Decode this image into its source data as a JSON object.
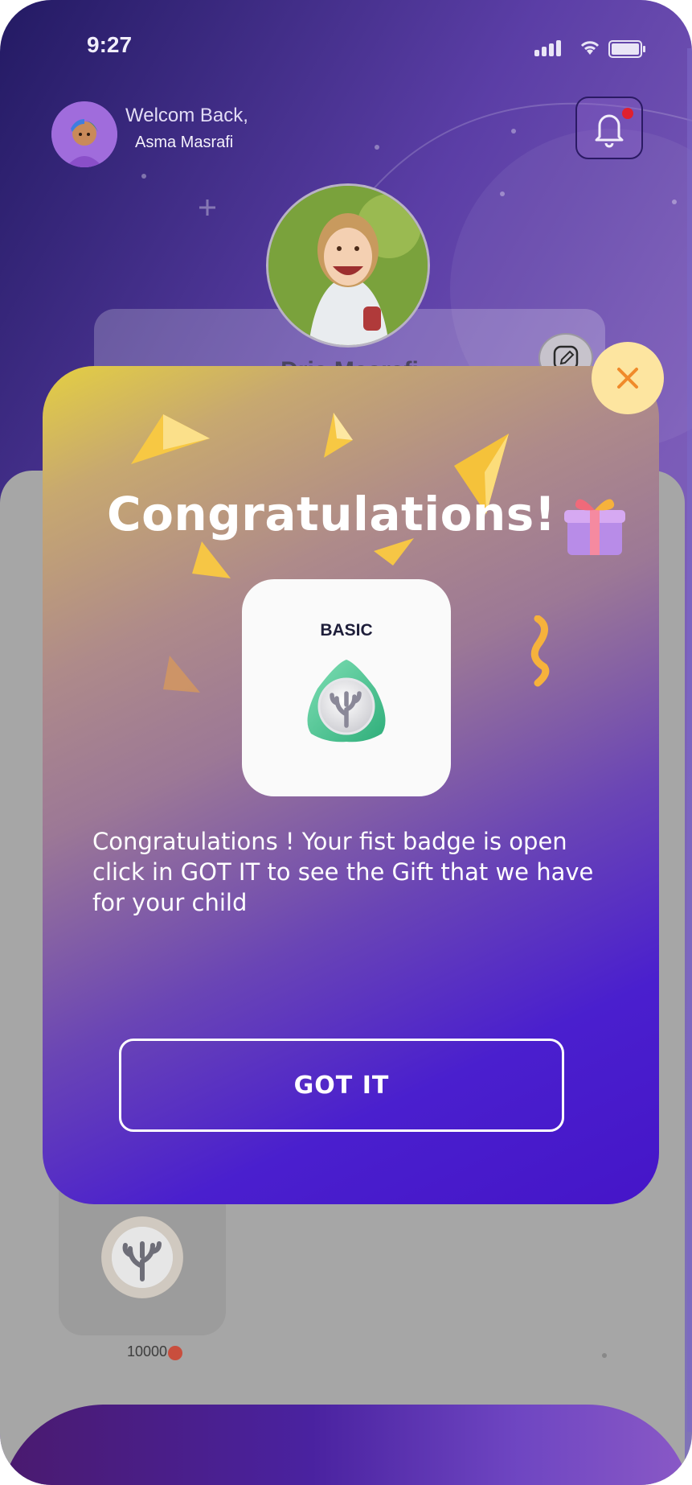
{
  "status_bar": {
    "time": "9:27"
  },
  "header": {
    "welcome_text": "Welcom Back,",
    "user_name": "Asma Masrafi"
  },
  "profile": {
    "child_name": "Dria Masrafi"
  },
  "background_badge": {
    "points": "10000"
  },
  "modal": {
    "title": "Congratulations!",
    "level_label": "BASIC",
    "message": "Congratulations ! Your fist badge is open click in GOT IT to see the Gift that we have for your child",
    "button_label": "GOT IT",
    "close_icon": "close-icon",
    "gift_icon": "gift-icon",
    "badge_icon": "coral-badge-icon"
  },
  "colors": {
    "modal_gradient_start": "#e4cf42",
    "modal_gradient_end": "#4515c8",
    "close_button_bg": "#fde5a0",
    "close_icon_color": "#f08a2a",
    "notification_dot": "#e0202e"
  }
}
